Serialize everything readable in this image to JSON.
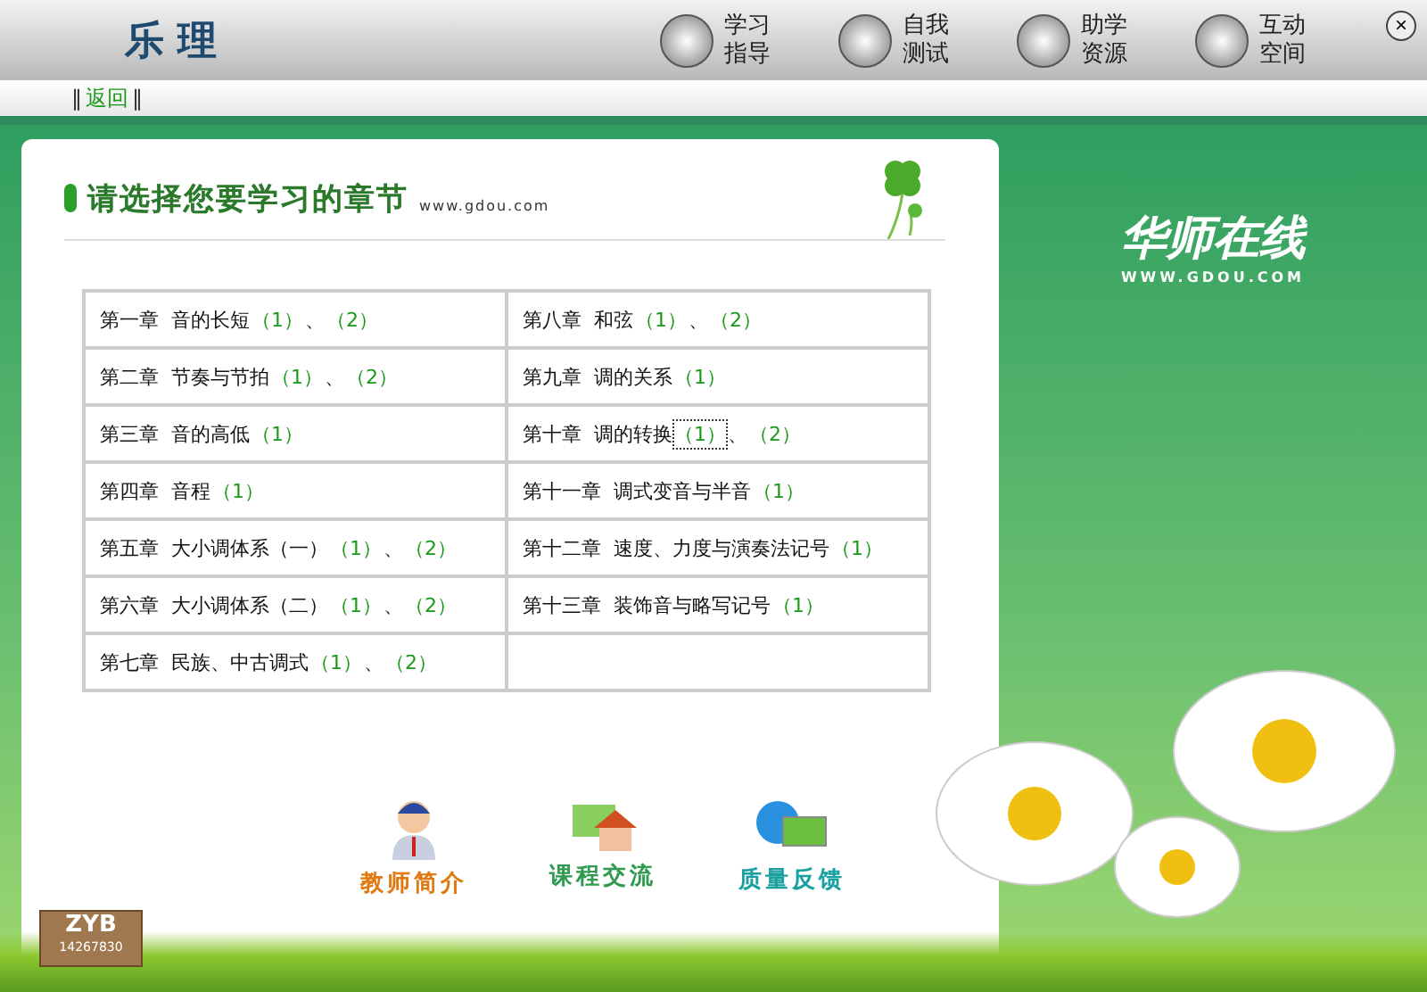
{
  "header": {
    "title": "乐 理",
    "nav": [
      {
        "line1": "学习",
        "line2": "指导"
      },
      {
        "line1": "自我",
        "line2": "测试"
      },
      {
        "line1": "助学",
        "line2": "资源"
      },
      {
        "line1": "互动",
        "line2": "空间"
      }
    ],
    "close": "×"
  },
  "toolbar": {
    "bar": "‖",
    "back": "返回"
  },
  "logo": {
    "name": "华师在线",
    "url": "WWW.GDOU.COM"
  },
  "panel": {
    "heading": "请选择您要学习的章节",
    "site": "www.gdou.com",
    "left": [
      {
        "label": "第一章  音的长短",
        "links": [
          {
            "text": "（1）",
            "focused": false
          },
          {
            "text": "（2）",
            "focused": false
          }
        ],
        "sep": "、"
      },
      {
        "label": "第二章  节奏与节拍",
        "links": [
          {
            "text": "（1）",
            "focused": false
          },
          {
            "text": "（2）",
            "focused": false
          }
        ],
        "sep": "、"
      },
      {
        "label": "第三章  音的高低",
        "links": [
          {
            "text": "（1）",
            "focused": false
          }
        ]
      },
      {
        "label": "第四章  音程",
        "links": [
          {
            "text": "（1）",
            "focused": false
          }
        ]
      },
      {
        "label": "第五章  大小调体系（一）",
        "links": [
          {
            "text": "（1）",
            "focused": false
          },
          {
            "text": "（2）",
            "focused": false
          }
        ],
        "sep": "、"
      },
      {
        "label": "第六章  大小调体系（二）",
        "links": [
          {
            "text": "（1）",
            "focused": false
          },
          {
            "text": "（2）",
            "focused": false
          }
        ],
        "sep": "、"
      },
      {
        "label": "第七章  民族、中古调式",
        "links": [
          {
            "text": "（1）",
            "focused": false
          },
          {
            "text": "（2）",
            "focused": false
          }
        ],
        "sep": "、"
      }
    ],
    "right": [
      {
        "label": "第八章  和弦",
        "links": [
          {
            "text": "（1）",
            "focused": false
          },
          {
            "text": "（2）",
            "focused": false
          }
        ],
        "sep": "、"
      },
      {
        "label": "第九章  调的关系",
        "links": [
          {
            "text": "（1）",
            "focused": false
          }
        ]
      },
      {
        "label": "第十章  调的转换",
        "links": [
          {
            "text": "（1）",
            "focused": true
          },
          {
            "text": "（2）",
            "focused": false
          }
        ],
        "sep": "、"
      },
      {
        "label": "第十一章  调式变音与半音",
        "links": [
          {
            "text": "（1）",
            "focused": false
          }
        ]
      },
      {
        "label": "第十二章  速度、力度与演奏法记号",
        "links": [
          {
            "text": "（1）",
            "focused": false
          }
        ]
      },
      {
        "label": "第十三章  装饰音与略写记号",
        "links": [
          {
            "text": "（1）",
            "focused": false
          }
        ]
      }
    ],
    "bottom_links": [
      {
        "kind": "teacher",
        "text": "教师简介"
      },
      {
        "kind": "forum",
        "text": "课程交流"
      },
      {
        "kind": "feedback",
        "text": "质量反馈"
      }
    ]
  },
  "sign": {
    "name": "ZYB",
    "number": "14267830"
  }
}
